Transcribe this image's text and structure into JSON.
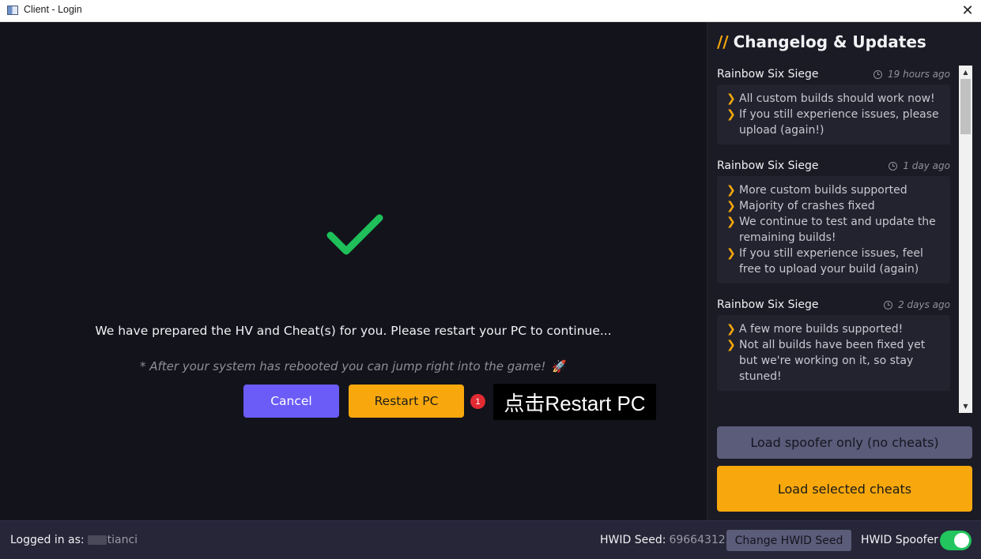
{
  "window": {
    "title": "Client - Login",
    "close_glyph": "✕"
  },
  "main": {
    "headline": "We have prepared the HV and Cheat(s) for you. Please restart your PC to continue...",
    "subline": "* After your system has rebooted you can jump right into the game!",
    "rocket": "🚀",
    "cancel_label": "Cancel",
    "restart_label": "Restart PC",
    "success_color": "#1fbf5a"
  },
  "annotation": {
    "badge": "1",
    "label": "点击Restart PC"
  },
  "sidebar": {
    "slashes": "//",
    "title": "Changelog & Updates",
    "entries": [
      {
        "game": "Rainbow Six Siege",
        "time": "19 hours ago",
        "lines": [
          "All custom builds should work now!",
          "If you still experience issues, please upload (again!)"
        ]
      },
      {
        "game": "Rainbow Six Siege",
        "time": "1 day ago",
        "lines": [
          "More custom builds supported",
          "Majority of crashes fixed",
          "We continue to test and update the remaining builds!",
          "If you still experience issues, feel free to upload your build (again)"
        ]
      },
      {
        "game": "Rainbow Six Siege",
        "time": "2 days ago",
        "lines": [
          "A few more builds supported!",
          "Not all builds have been fixed yet but we're working on it, so stay stuned!"
        ]
      }
    ],
    "spoofer_label": "Load spoofer only (no cheats)",
    "load_label": "Load selected cheats"
  },
  "statusbar": {
    "logged_label": "Logged in as:",
    "username": "tianci",
    "hwid_label": "HWID Seed:",
    "hwid_value": "696643125",
    "change_hwid_label": "Change HWID Seed",
    "spoofer_label": "HWID Spoofer",
    "spoofer_enabled": true
  },
  "colors": {
    "accent": "#f8a80c",
    "primary": "#6b5cf7",
    "toggle_on": "#22c55e"
  }
}
